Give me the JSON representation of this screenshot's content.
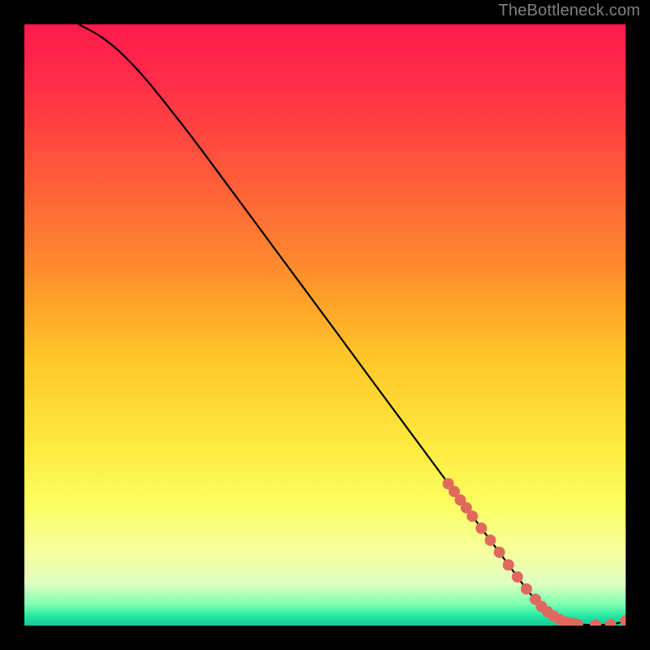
{
  "watermark": "TheBottleneck.com",
  "gradient_stops": [
    {
      "offset": 0,
      "color": "#ff1a4d"
    },
    {
      "offset": 0.1,
      "color": "#ff2e47"
    },
    {
      "offset": 0.25,
      "color": "#ff5a3a"
    },
    {
      "offset": 0.4,
      "color": "#ff8a2e"
    },
    {
      "offset": 0.55,
      "color": "#ffc527"
    },
    {
      "offset": 0.7,
      "color": "#ffe93f"
    },
    {
      "offset": 0.8,
      "color": "#fbff60"
    },
    {
      "offset": 0.88,
      "color": "#f6ffa0"
    },
    {
      "offset": 0.93,
      "color": "#dfffc2"
    },
    {
      "offset": 0.965,
      "color": "#7cffb0"
    },
    {
      "offset": 0.985,
      "color": "#1fe6a2"
    },
    {
      "offset": 1.0,
      "color": "#15c79a"
    }
  ],
  "chart_data": {
    "type": "line",
    "title": "",
    "xlabel": "",
    "ylabel": "",
    "xlim": [
      0,
      100
    ],
    "ylim": [
      0,
      100
    ],
    "series": [
      {
        "name": "curve",
        "x": [
          9,
          12,
          15,
          18,
          21,
          24,
          28,
          32,
          36,
          40,
          45,
          50,
          55,
          60,
          65,
          70,
          73,
          76,
          79,
          82,
          84,
          86,
          88,
          90,
          92,
          94,
          96,
          98,
          100
        ],
        "y": [
          100,
          98.5,
          96.3,
          93.4,
          90.0,
          86.2,
          81.1,
          75.7,
          70.3,
          64.9,
          58.1,
          51.4,
          44.6,
          37.8,
          31.1,
          24.3,
          20.3,
          16.2,
          12.2,
          8.1,
          5.4,
          3.2,
          1.6,
          0.6,
          0.2,
          0.1,
          0.1,
          0.2,
          0.8
        ]
      }
    ],
    "markers": [
      {
        "x": 70.5,
        "y": 23.6
      },
      {
        "x": 71.5,
        "y": 22.3
      },
      {
        "x": 72.5,
        "y": 20.9
      },
      {
        "x": 73.5,
        "y": 19.6
      },
      {
        "x": 74.5,
        "y": 18.2
      },
      {
        "x": 76.0,
        "y": 16.2
      },
      {
        "x": 77.5,
        "y": 14.2
      },
      {
        "x": 79.0,
        "y": 12.2
      },
      {
        "x": 80.5,
        "y": 10.1
      },
      {
        "x": 82.0,
        "y": 8.1
      },
      {
        "x": 83.5,
        "y": 6.1
      },
      {
        "x": 85.0,
        "y": 4.4
      },
      {
        "x": 86.0,
        "y": 3.2
      },
      {
        "x": 87.0,
        "y": 2.3
      },
      {
        "x": 88.0,
        "y": 1.6
      },
      {
        "x": 89.0,
        "y": 1.0
      },
      {
        "x": 90.0,
        "y": 0.6
      },
      {
        "x": 91.0,
        "y": 0.4
      },
      {
        "x": 92.0,
        "y": 0.2
      },
      {
        "x": 95.0,
        "y": 0.1
      },
      {
        "x": 97.5,
        "y": 0.15
      },
      {
        "x": 100.0,
        "y": 0.8
      }
    ],
    "marker_color": "#e0695e",
    "marker_radius": 7,
    "line_color": "#000000",
    "line_width": 2.2
  }
}
